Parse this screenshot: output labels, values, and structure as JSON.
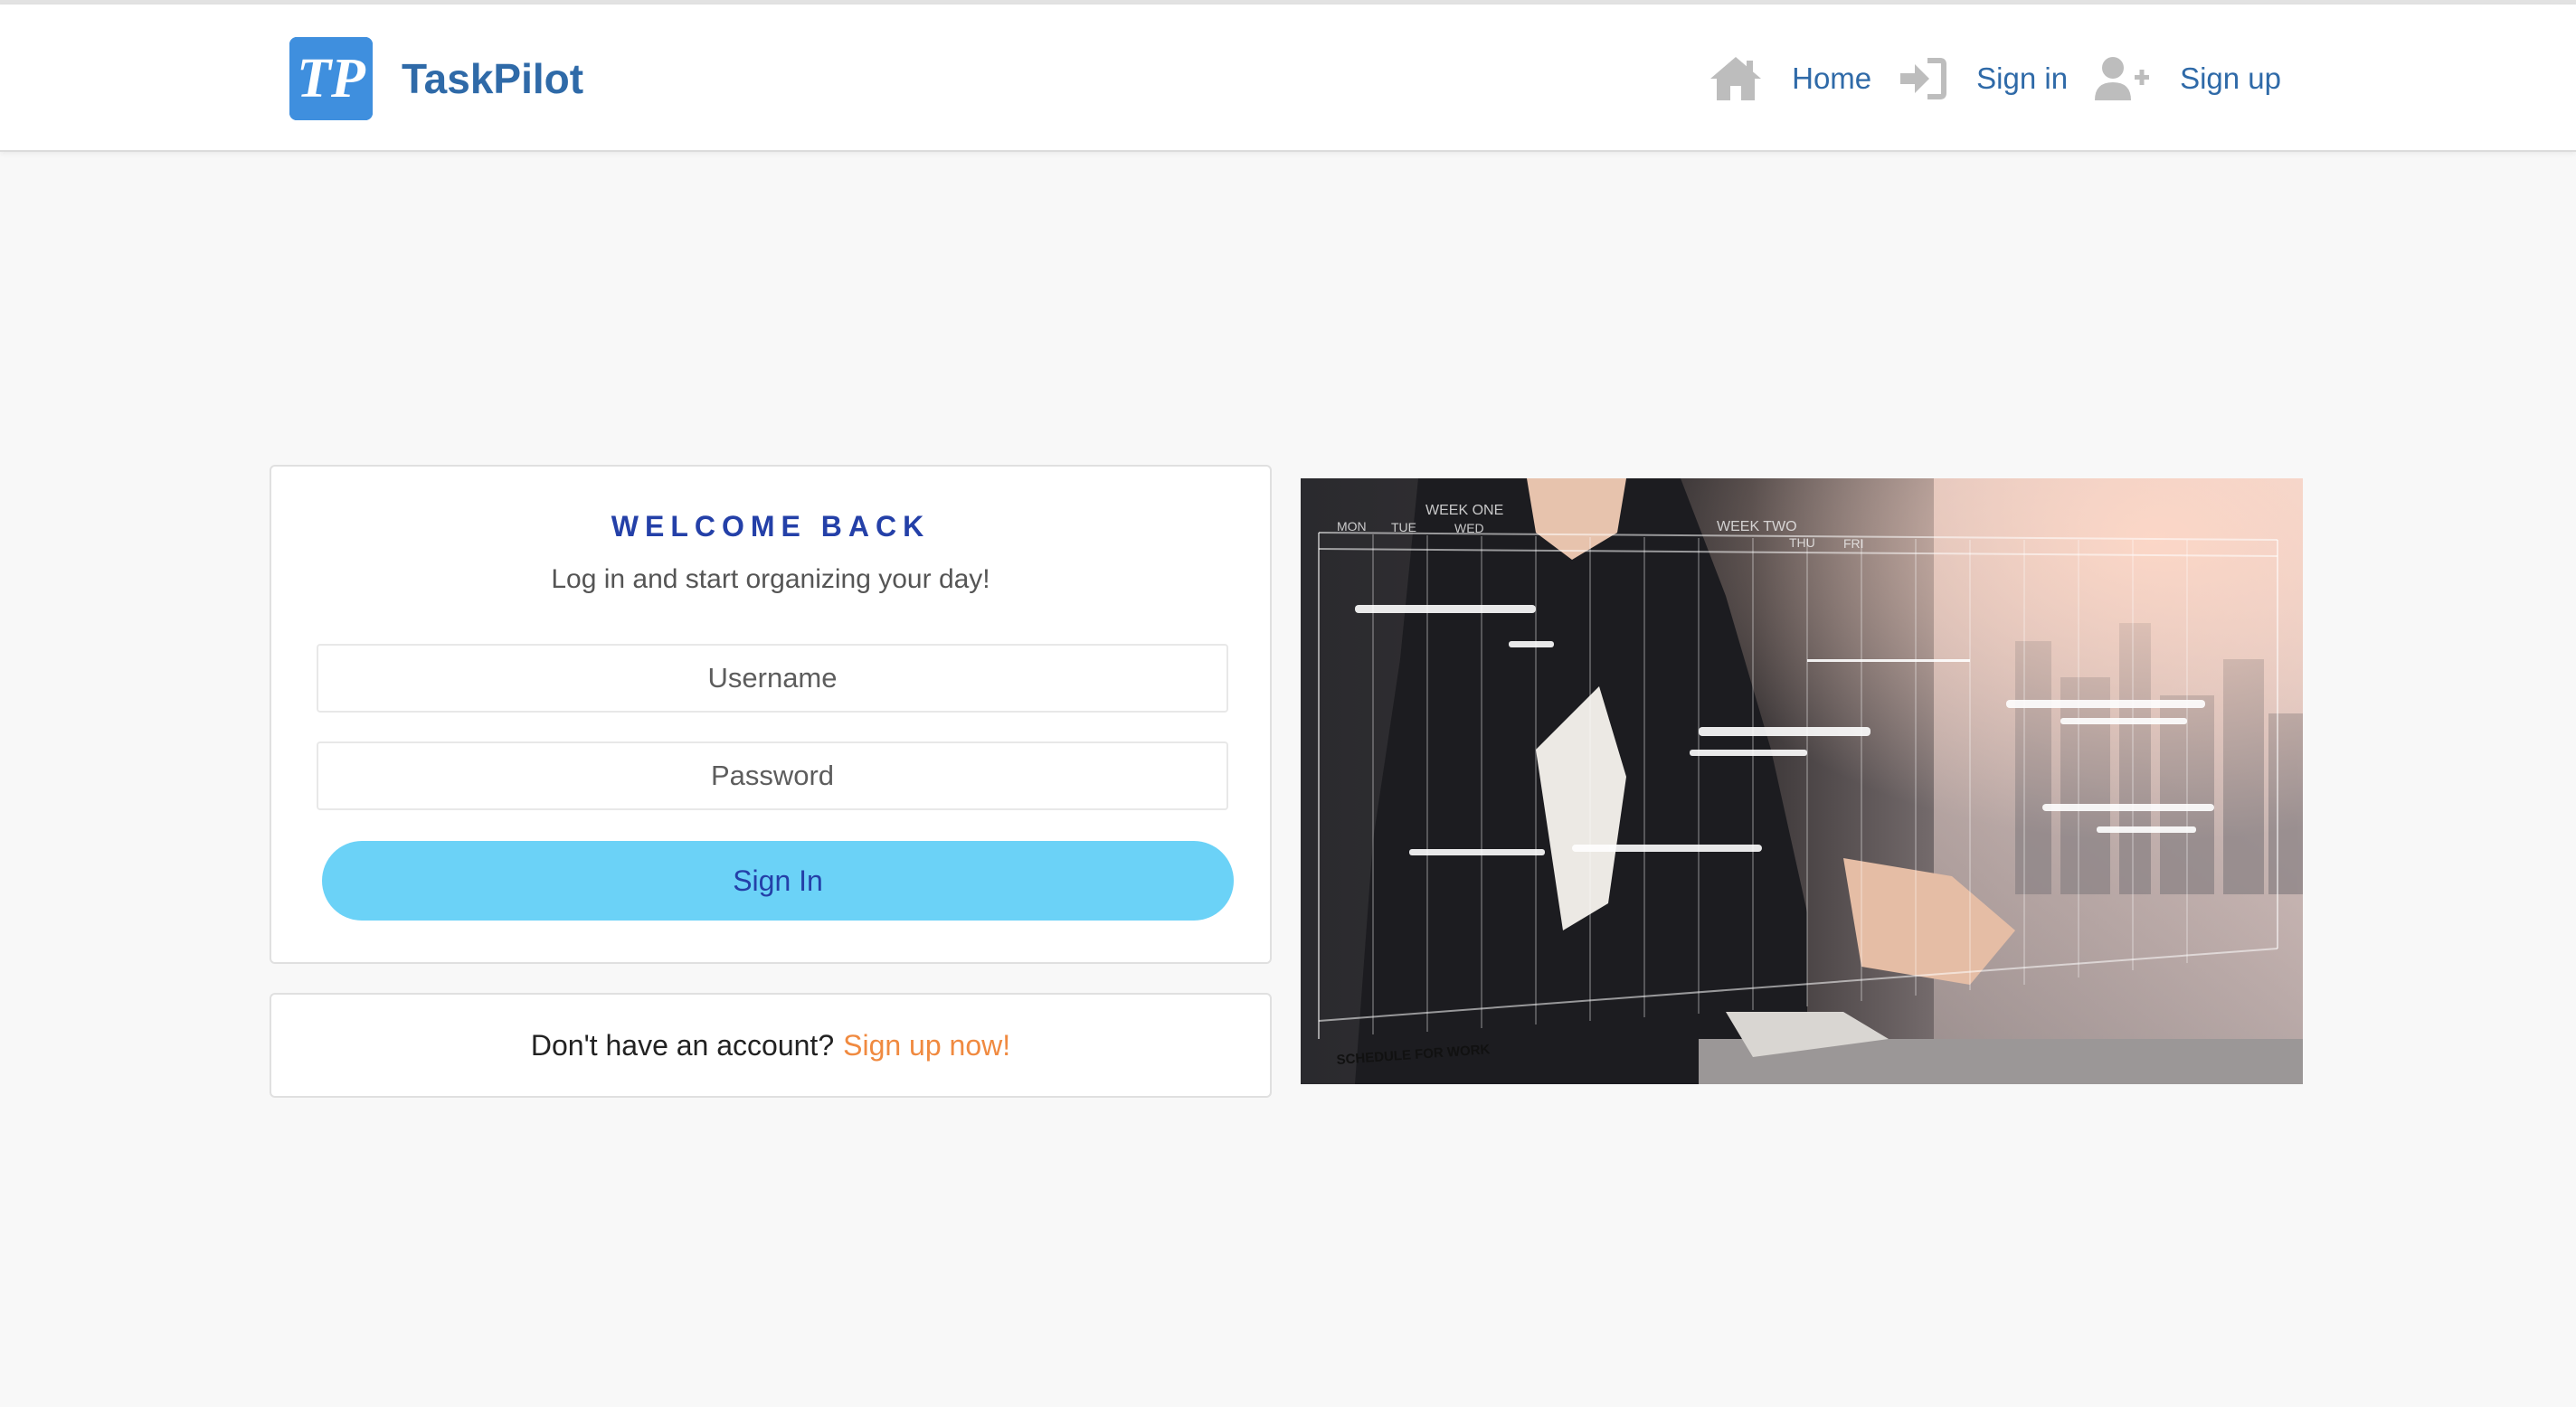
{
  "brand": {
    "name": "TaskPilot",
    "logo_text": "TP",
    "logo_color": "#3f8fde"
  },
  "nav": {
    "items": [
      {
        "label": "Home",
        "icon": "home-icon"
      },
      {
        "label": "Sign in",
        "icon": "sign-in-icon"
      },
      {
        "label": "Sign up",
        "icon": "user-plus-icon"
      }
    ]
  },
  "login": {
    "title": "WELCOME BACK",
    "subtitle": "Log in and start organizing your day!",
    "username_placeholder": "Username",
    "password_placeholder": "Password",
    "submit_label": "Sign In"
  },
  "signup_prompt": {
    "text": "Don't have an account?",
    "link": "Sign up now!"
  },
  "hero": {
    "board_text": "SCHEDULE FOR WORK",
    "week_one": "WEEK ONE",
    "week_two": "WEEK TWO",
    "days": [
      "MON",
      "TUE",
      "WED",
      "THU",
      "FRI"
    ]
  },
  "colors": {
    "accent": "#2f6aa8",
    "title": "#2440a8",
    "button": "#6bd2f7",
    "link": "#f08a40",
    "background": "#f8f8f8"
  }
}
